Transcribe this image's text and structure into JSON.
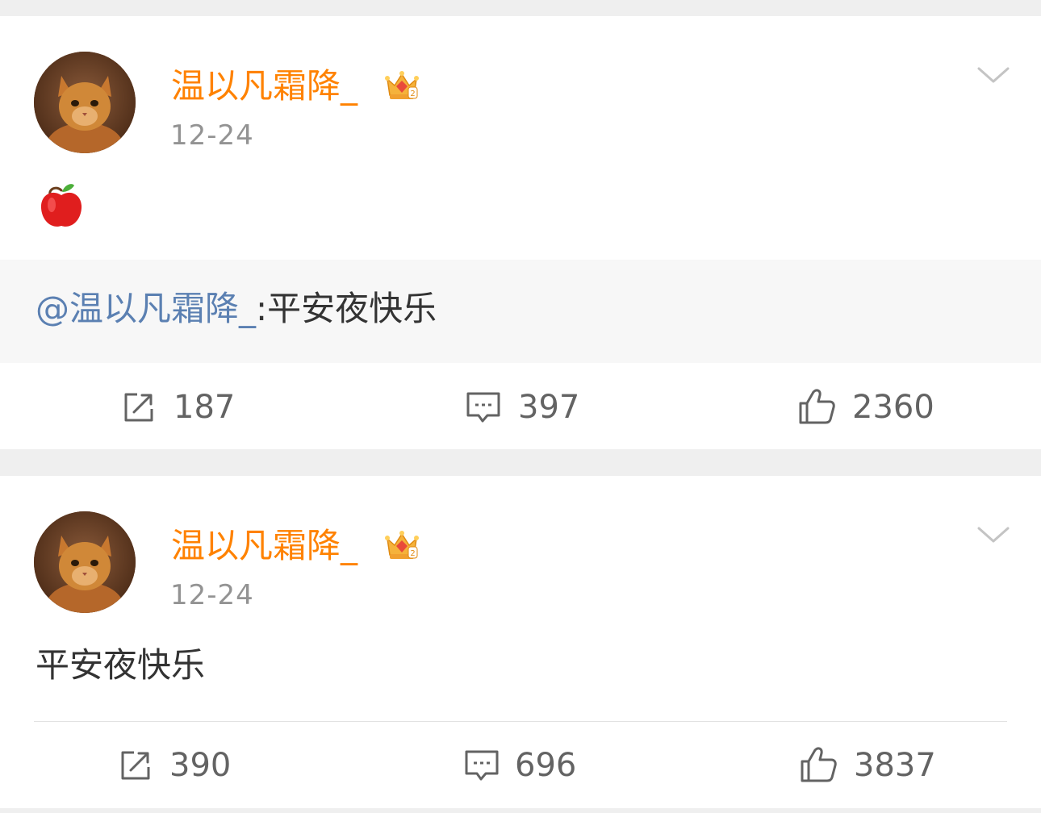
{
  "posts": [
    {
      "username": "温以凡霜降_",
      "time": "12-24",
      "content_emoji": "apple-emoji",
      "repost": {
        "mention": "@温以凡霜降_",
        "text": ":平安夜快乐"
      },
      "actions": {
        "share_count": "187",
        "comment_count": "397",
        "like_count": "2360"
      }
    },
    {
      "username": "温以凡霜降_",
      "time": "12-24",
      "text": "平安夜快乐",
      "actions": {
        "share_count": "390",
        "comment_count": "696",
        "like_count": "3837"
      }
    }
  ],
  "icons": {
    "share": "share-icon",
    "comment": "comment-icon",
    "like": "thumbs-up-icon",
    "menu": "chevron-down-icon",
    "badge": "crown-badge-icon"
  },
  "colors": {
    "username": "#ff8200",
    "mention": "#5b80b2",
    "timestamp": "#939393",
    "count": "#636363",
    "background": "#efefef"
  }
}
